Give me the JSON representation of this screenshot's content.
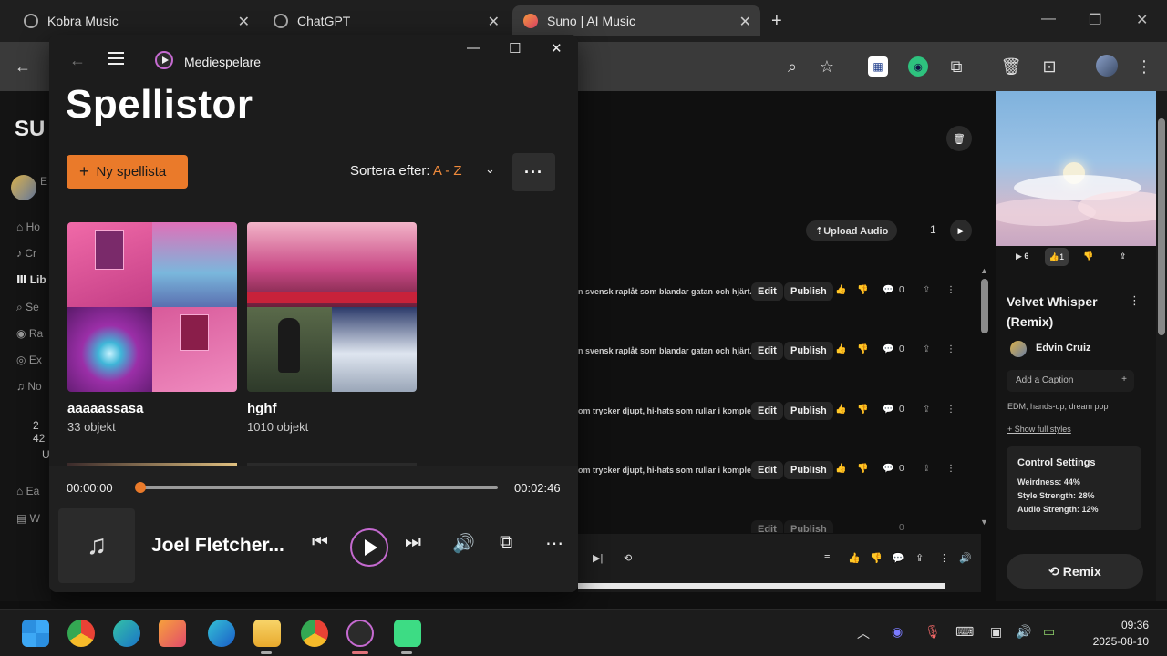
{
  "browser": {
    "tabs": [
      {
        "label": "Kobra Music"
      },
      {
        "label": "ChatGPT"
      },
      {
        "label": "Suno | AI Music"
      }
    ],
    "new_tab": "+"
  },
  "suno": {
    "logo": "SU",
    "upload_label": "⇡Upload Audio",
    "page_number": "1",
    "rows": [
      {
        "desc": "n svensk raplåt som blandar gatan och hjärt...",
        "edit": "Edit",
        "publish": "Publish",
        "comments": "0"
      },
      {
        "desc": "n svensk raplåt som blandar gatan och hjärt...",
        "edit": "Edit",
        "publish": "Publish",
        "comments": "0"
      },
      {
        "desc": "om trycker djupt, hi-hats som rullar i komple...",
        "edit": "Edit",
        "publish": "Publish",
        "comments": "0"
      },
      {
        "desc": "om trycker djupt, hi-hats som rullar i komple...",
        "edit": "Edit",
        "publish": "Publish",
        "comments": "0"
      },
      {
        "desc": "",
        "edit": "Edit",
        "publish": "Publish",
        "comments": "0"
      }
    ],
    "side_labels": [
      "E",
      "Ho",
      "Cr",
      "Lib",
      "Se",
      "Ra",
      "Ex",
      "No",
      "2 42",
      "U",
      "Ea",
      "W"
    ],
    "panel": {
      "plays": "▶ 6",
      "likes": "1",
      "title": "Velvet Whisper (Remix)",
      "user": "Edvin Cruiz",
      "caption_placeholder": "Add a Caption",
      "caption_plus": "+",
      "tags": "EDM, hands-up, dream pop",
      "show_styles": "+ Show full styles",
      "control_title": "Control Settings",
      "weirdness": "Weirdness: 44%",
      "style_strength": "Style Strength: 28%",
      "audio_strength": "Audio Strength: 12%",
      "remix_label": "⟲ Remix"
    }
  },
  "mediaplayer": {
    "app_name": "Mediespelare",
    "heading": "Spellistor",
    "new_playlist": "Ny spellista",
    "sort_label": "Sortera efter:",
    "sort_value": "A - Z",
    "more": "···",
    "playlists": [
      {
        "name": "aaaaassasa",
        "count": "33 objekt"
      },
      {
        "name": "hghf",
        "count": "1010 objekt"
      }
    ],
    "player": {
      "current_time": "00:00:00",
      "total_time": "00:02:46",
      "progress": 0.0,
      "now_playing": "Joel Fletcher..."
    }
  },
  "taskbar": {
    "time": "09:36",
    "date": "2025-08-10"
  }
}
